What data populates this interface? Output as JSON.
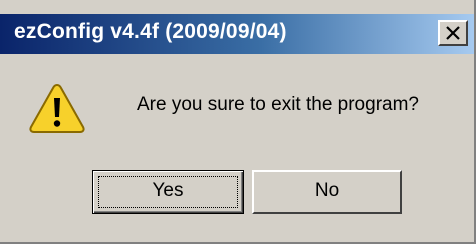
{
  "window": {
    "title": "ezConfig v4.4f (2009/09/04)",
    "close_icon": "close-x-icon"
  },
  "message": {
    "icon": "warning-icon",
    "text": "Are you sure to exit the program?"
  },
  "buttons": {
    "yes_label": "Yes",
    "no_label": "No"
  },
  "colors": {
    "titlebar_start": "#0a246a",
    "titlebar_end": "#a6caf0",
    "face": "#d4d0c8",
    "warning_yellow": "#f7d12b"
  }
}
